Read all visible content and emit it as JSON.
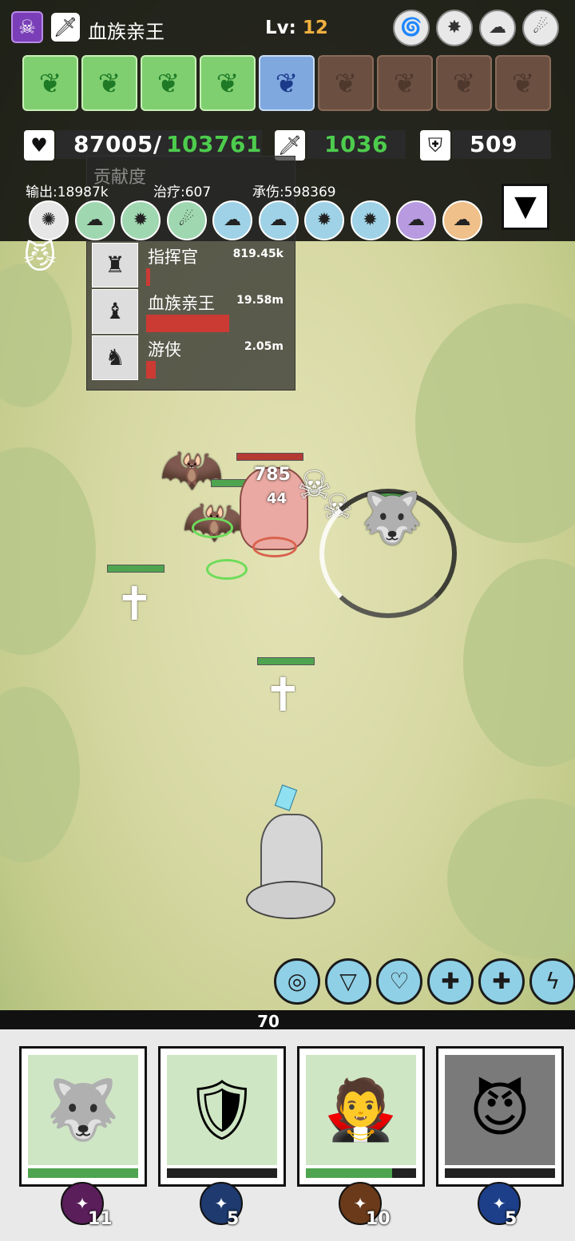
{
  "header": {
    "hero_name": "血族亲王",
    "level_label": "Lv:",
    "level_value": "12",
    "hero_icon": "skull-icon",
    "weapon_icon": "sword-icon",
    "buff_icons": [
      "tornado-icon",
      "spike-icon",
      "cloud-icon",
      "claw-icon"
    ]
  },
  "slots": [
    {
      "state": "green",
      "icon": "leaf-icon"
    },
    {
      "state": "green",
      "icon": "leaf-icon"
    },
    {
      "state": "green",
      "icon": "leaf-icon"
    },
    {
      "state": "green",
      "icon": "leaf-icon"
    },
    {
      "state": "blue",
      "icon": "leaf-icon"
    },
    {
      "state": "locked",
      "icon": "leaf-icon"
    },
    {
      "state": "locked",
      "icon": "leaf-icon"
    },
    {
      "state": "locked",
      "icon": "leaf-icon"
    },
    {
      "state": "locked",
      "icon": "leaf-icon"
    }
  ],
  "stats": {
    "hp_current": "87005/",
    "hp_max": "103761",
    "attack": "1036",
    "defense": "509",
    "output_label": "输出:18987k",
    "heal_label": "治疗:607",
    "damage_taken_label": "承伤:598369"
  },
  "team_members": [
    {
      "color": "#e6e6e6",
      "glyph": "✺"
    },
    {
      "color": "#9fd7b0",
      "glyph": "☁"
    },
    {
      "color": "#9fd7b0",
      "glyph": "✹"
    },
    {
      "color": "#9fd7b0",
      "glyph": "☄"
    },
    {
      "color": "#9fd2e6",
      "glyph": "☁"
    },
    {
      "color": "#9fd2e6",
      "glyph": "☁"
    },
    {
      "color": "#9fd2e6",
      "glyph": "✹"
    },
    {
      "color": "#9fd2e6",
      "glyph": "✹"
    },
    {
      "color": "#b79ae0",
      "glyph": "☁"
    },
    {
      "color": "#f0c08a",
      "glyph": "☁"
    }
  ],
  "contribution": {
    "title": "贡献度",
    "rows": [
      {
        "name": "指挥官",
        "value": "819.45k",
        "bar_fraction": 0.04
      },
      {
        "name": "血族亲王",
        "value": "19.58m",
        "bar_fraction": 0.6
      },
      {
        "name": "游侠",
        "value": "2.05m",
        "bar_fraction": 0.08
      }
    ]
  },
  "battle": {
    "damage_numbers": [
      "785",
      "44"
    ]
  },
  "skills": [
    {
      "icon": "vortex-icon",
      "color": "#8fd0e6"
    },
    {
      "icon": "shield-down-icon",
      "color": "#8fd0e6"
    },
    {
      "icon": "heart-icon",
      "color": "#8fd0e6"
    },
    {
      "icon": "heart-plus-icon",
      "color": "#8fd0e6"
    },
    {
      "icon": "heart-plus-icon",
      "color": "#8fd0e6"
    },
    {
      "icon": "lightning-icon",
      "color": "#8fd0e6"
    }
  ],
  "energy": "70",
  "cards": [
    {
      "name": "beast-card",
      "hp_fraction": 1.0,
      "cost": "11",
      "cost_color": "#5a1e5a",
      "bg": "#cfe6c4"
    },
    {
      "name": "knight-card",
      "hp_fraction": 0.0,
      "cost": "5",
      "cost_color": "#1e3a6e",
      "bg": "#cfe6c4"
    },
    {
      "name": "vampire-card",
      "hp_fraction": 0.78,
      "cost": "10",
      "cost_color": "#6a3a1a",
      "bg": "#cfe6c4"
    },
    {
      "name": "demon-card",
      "hp_fraction": 0.0,
      "cost": "5",
      "cost_color": "#1d3f8a",
      "bg": "#7a7a7a"
    }
  ]
}
